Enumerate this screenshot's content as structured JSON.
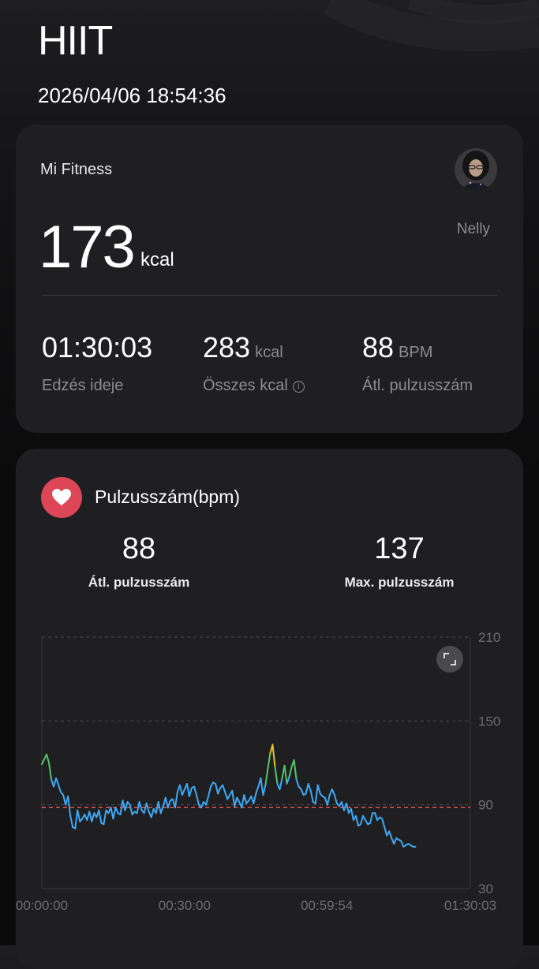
{
  "header": {
    "title": "HIIT",
    "datetime": "2026/04/06 18:54:36"
  },
  "summary": {
    "app_name": "Mi Fitness",
    "user_name": "Nelly",
    "calories_value": "173",
    "calories_unit": "kcal",
    "stats": [
      {
        "value": "01:30:03",
        "unit": "",
        "label": "Edzés ideje"
      },
      {
        "value": "283",
        "unit": "kcal",
        "label": "Összes kcal"
      },
      {
        "value": "88",
        "unit": "BPM",
        "label": "Átl. pulzusszám"
      }
    ]
  },
  "heart_rate": {
    "title": "Pulzusszám(bpm)",
    "avg_value": "88",
    "avg_label": "Átl. pulzusszám",
    "max_value": "137",
    "max_label": "Max. pulzusszám"
  },
  "icons": {
    "heart": "heart-icon",
    "expand": "expand-icon",
    "info": "info-icon"
  },
  "colors": {
    "accent_red": "#dc4656",
    "line_blue": "#3fa9f5",
    "line_green": "#52c768",
    "line_yellow": "#e8c22c",
    "average_line": "#e04f4f"
  },
  "chart_data": {
    "type": "line",
    "title": "",
    "xlabel": "",
    "ylabel": "",
    "ylim": [
      30,
      210
    ],
    "y_ticks": [
      "30",
      "90",
      "150",
      "210"
    ],
    "x_ticks": [
      "00:00:00",
      "00:30:00",
      "00:59:54",
      "01:30:03"
    ],
    "x_tick_minutes": [
      0,
      30,
      59.9,
      90.05
    ],
    "xlim_minutes": [
      0,
      90.05
    ],
    "grid": true,
    "average_line": 88,
    "series": [
      {
        "x_minutes": [
          0,
          1,
          1.5,
          2,
          2.5,
          3,
          3.5,
          4,
          4.5,
          5,
          5.5,
          6,
          6.5,
          7,
          7.5,
          8,
          8.5,
          9,
          9.5,
          10,
          10.5,
          11,
          11.5,
          12,
          12.5,
          13,
          13.5,
          14,
          14.5,
          15,
          15.5,
          16,
          16.5,
          17,
          17.5,
          18,
          18.5,
          19,
          19.5,
          20,
          20.5,
          21,
          21.5,
          22,
          22.5,
          23,
          23.5,
          24,
          24.5,
          25,
          25.5,
          26,
          26.5,
          27,
          27.5,
          28,
          28.5,
          29,
          29.5,
          30,
          30.5,
          31,
          31.5,
          32,
          32.5,
          33,
          33.5,
          34,
          34.5,
          35,
          35.5,
          36,
          36.5,
          37,
          37.5,
          38,
          38.5,
          39,
          39.5,
          40,
          40.5,
          41,
          41.5,
          42,
          42.5,
          43,
          43.5,
          44,
          44.5,
          45,
          45.5,
          46,
          46.5,
          47,
          47.5,
          48,
          48.5,
          49,
          49.5,
          50,
          50.5,
          51,
          51.5,
          52,
          52.5,
          53,
          53.5,
          54,
          54.5,
          55,
          55.5,
          56,
          56.5,
          57,
          57.5,
          58,
          58.5,
          59,
          59.5,
          60,
          60.5,
          61,
          61.5,
          62,
          62.5,
          63,
          63.5,
          64,
          64.5,
          65,
          65.5,
          66,
          66.5,
          67,
          67.5,
          68,
          68.5,
          69,
          69.5,
          70,
          70.5,
          71,
          71.5,
          72,
          72.5,
          73,
          73.5,
          74,
          74.5,
          75,
          75.5,
          76,
          76.5,
          77,
          77.5,
          78,
          78.5,
          79,
          79.5,
          80,
          80.5,
          81,
          81.5,
          82,
          82.5,
          83,
          83.5,
          84,
          84.5,
          85,
          85.5,
          86,
          86.5,
          87,
          87.5,
          88,
          88.5,
          89,
          89.5,
          90.05
        ],
        "values": [
          119,
          126,
          120,
          108,
          103,
          109,
          104,
          99,
          97,
          90,
          96,
          82,
          74,
          73,
          86,
          78,
          80,
          83,
          79,
          85,
          78,
          84,
          81,
          86,
          77,
          76,
          86,
          84,
          88,
          80,
          88,
          84,
          83,
          93,
          86,
          92,
          90,
          83,
          85,
          84,
          92,
          86,
          84,
          91,
          85,
          81,
          87,
          84,
          92,
          84,
          89,
          95,
          88,
          93,
          94,
          88,
          99,
          104,
          97,
          101,
          105,
          96,
          102,
          103,
          97,
          90,
          88,
          92,
          90,
          96,
          103,
          106,
          105,
          98,
          102,
          104,
          99,
          94,
          97,
          100,
          89,
          95,
          92,
          88,
          97,
          91,
          93,
          96,
          91,
          98,
          103,
          109,
          97,
          104,
          116,
          127,
          133,
          117,
          105,
          101,
          109,
          118,
          105,
          110,
          117,
          122,
          108,
          103,
          101,
          97,
          98,
          105,
          100,
          92,
          91,
          104,
          98,
          96,
          95,
          90,
          97,
          101,
          97,
          91,
          89,
          92,
          86,
          91,
          84,
          87,
          79,
          82,
          75,
          76,
          82,
          79,
          76,
          77,
          84,
          84,
          79,
          81,
          80,
          74,
          68,
          71,
          66,
          62,
          66,
          65,
          64,
          60,
          61,
          62,
          61,
          60,
          60
        ]
      }
    ]
  }
}
